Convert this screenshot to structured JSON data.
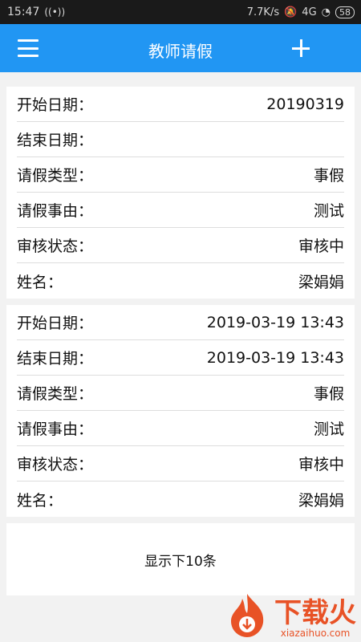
{
  "status_bar": {
    "time": "15:47",
    "signal_icon": "radio-wave-icon",
    "speed": "7.7K/s",
    "network": "4G",
    "battery": "58"
  },
  "app_bar": {
    "title": "教师请假",
    "menu_icon": "hamburger-menu-icon",
    "add_icon": "plus-icon"
  },
  "records": [
    {
      "start_label": "开始日期：",
      "start_value": "20190319",
      "end_label": "结束日期：",
      "end_value": "",
      "type_label": "请假类型：",
      "type_value": "事假",
      "reason_label": "请假事由：",
      "reason_value": "测试",
      "status_label": "审核状态：",
      "status_value": "审核中",
      "name_label": "姓名：",
      "name_value": "梁娟娟"
    },
    {
      "start_label": "开始日期：",
      "start_value": "2019-03-19 13:43",
      "end_label": "结束日期：",
      "end_value": "2019-03-19 13:43",
      "type_label": "请假类型：",
      "type_value": "事假",
      "reason_label": "请假事由：",
      "reason_value": "测试",
      "status_label": "审核状态：",
      "status_value": "审核中",
      "name_label": "姓名：",
      "name_value": "梁娟娟"
    }
  ],
  "load_more": "显示下10条",
  "watermark": {
    "title": "下载火",
    "sub": "xiazaihuo.com"
  },
  "colors": {
    "primary": "#2196f3",
    "watermark": "#e84a1c"
  }
}
